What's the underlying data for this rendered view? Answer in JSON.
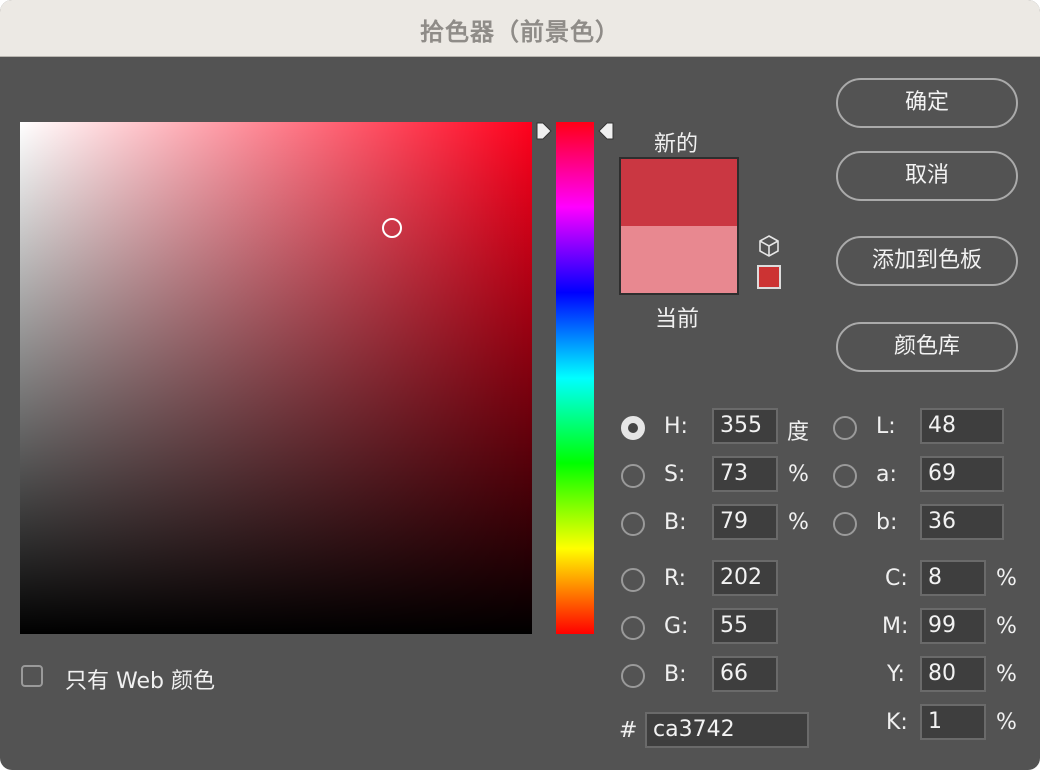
{
  "window": {
    "title": "拾色器（前景色）"
  },
  "swatch": {
    "new_label": "新的",
    "current_label": "当前",
    "new_color": "#ca3742",
    "current_color": "#e88890",
    "websafe_color": "#cc3333"
  },
  "buttons": {
    "ok": "确定",
    "cancel": "取消",
    "add_to_swatches": "添加到色板",
    "color_libraries": "颜色库"
  },
  "hsb": {
    "h_label": "H:",
    "h_value": "355",
    "h_unit": "度",
    "s_label": "S:",
    "s_value": "73",
    "s_unit": "%",
    "b_label": "B:",
    "b_value": "79",
    "b_unit": "%"
  },
  "lab": {
    "l_label": "L:",
    "l_value": "48",
    "a_label": "a:",
    "a_value": "69",
    "b_label": "b:",
    "b_value": "36"
  },
  "rgb": {
    "r_label": "R:",
    "r_value": "202",
    "g_label": "G:",
    "g_value": "55",
    "b_label": "B:",
    "b_value": "66"
  },
  "cmyk": {
    "c_label": "C:",
    "c_value": "8",
    "c_unit": "%",
    "m_label": "M:",
    "m_value": "99",
    "m_unit": "%",
    "y_label": "Y:",
    "y_value": "80",
    "y_unit": "%",
    "k_label": "K:",
    "k_value": "1",
    "k_unit": "%"
  },
  "hex": {
    "label": "#",
    "value": "ca3742"
  },
  "web_only": {
    "label": "只有 Web 颜色",
    "checked": false
  },
  "colors": {
    "accent_hue": "#ff001c"
  }
}
